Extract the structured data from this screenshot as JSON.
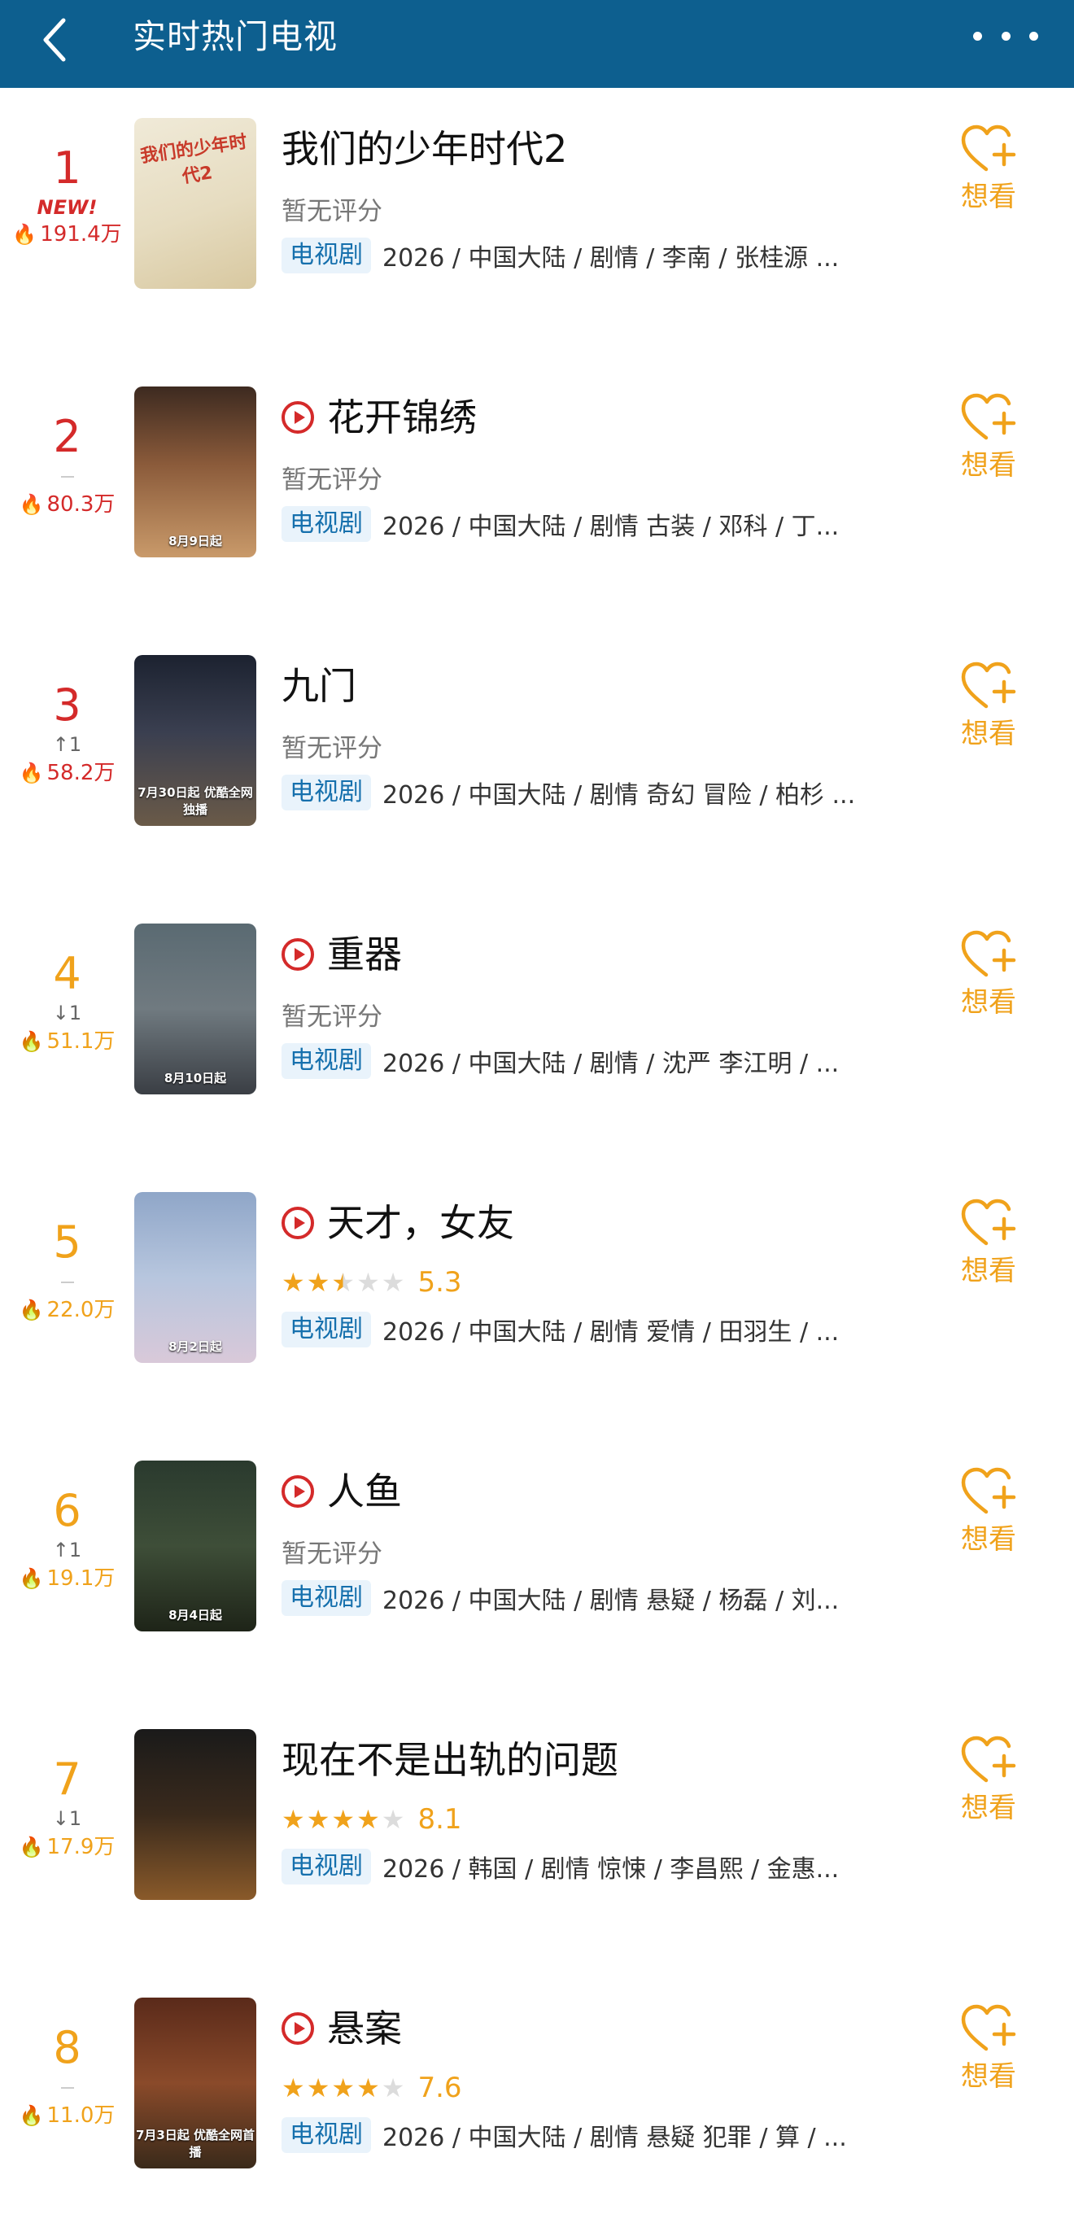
{
  "header": {
    "title": "实时热门电视",
    "back_icon": "back-arrow-icon",
    "more_icon": "more-dots-icon"
  },
  "no_rating_text": "暂无评分",
  "want_label": "想看",
  "colors": {
    "header_bg": "#0d5f8f",
    "hot": "#d42a2a",
    "warm": "#f0a21b",
    "tag_text": "#1670ad"
  },
  "items": [
    {
      "rank": "1",
      "is_new": true,
      "new_label": "NEW!",
      "change": "",
      "heat": "191.4万",
      "hot": true,
      "playable": false,
      "title": "我们的少年时代2",
      "rated": false,
      "stars": 0,
      "score": "",
      "tag": "电视剧",
      "meta": "2026 / 中国大陆 / 剧情 / 李南 / 张桂源 ...",
      "poster_text": "我们的少年时代2",
      "poster_caption": "",
      "poster_bg": "linear-gradient(160deg,#f0ead8 0%,#e6dcc0 55%,#d8c8a0 100%)"
    },
    {
      "rank": "2",
      "is_new": false,
      "new_label": "",
      "change": "",
      "heat": "80.3万",
      "hot": true,
      "playable": true,
      "title": "花开锦绣",
      "rated": false,
      "stars": 0,
      "score": "",
      "tag": "电视剧",
      "meta": "2026 / 中国大陆 / 剧情 古装 / 邓科 / 丁...",
      "poster_text": "",
      "poster_caption": "8月9日起",
      "poster_bg": "linear-gradient(180deg,#3d2a20 0%,#8a5a3a 45%,#c99a6a 100%)"
    },
    {
      "rank": "3",
      "is_new": false,
      "new_label": "",
      "change": "↑1",
      "heat": "58.2万",
      "hot": true,
      "playable": false,
      "title": "九门",
      "rated": false,
      "stars": 0,
      "score": "",
      "tag": "电视剧",
      "meta": "2026 / 中国大陆 / 剧情 奇幻 冒险 / 柏杉 ...",
      "poster_text": "",
      "poster_caption": "7月30日起 优酷全网独播",
      "poster_bg": "linear-gradient(180deg,#1c2230 0%,#3a3f50 45%,#6a5a48 100%)"
    },
    {
      "rank": "4",
      "is_new": false,
      "new_label": "",
      "change": "↓1",
      "heat": "51.1万",
      "hot": false,
      "playable": true,
      "title": "重器",
      "rated": false,
      "stars": 0,
      "score": "",
      "tag": "电视剧",
      "meta": "2026 / 中国大陆 / 剧情 / 沈严 李江明 / ...",
      "poster_text": "",
      "poster_caption": "8月10日起",
      "poster_bg": "linear-gradient(180deg,#5a6a72 0%,#707a80 50%,#3a3e44 100%)"
    },
    {
      "rank": "5",
      "is_new": false,
      "new_label": "",
      "change": "",
      "heat": "22.0万",
      "hot": false,
      "playable": true,
      "title": "天才，女友",
      "rated": true,
      "stars": 2.5,
      "score": "5.3",
      "tag": "电视剧",
      "meta": "2026 / 中国大陆 / 剧情 爱情 / 田羽生 / ...",
      "poster_text": "",
      "poster_caption": "8月2日起",
      "poster_bg": "linear-gradient(180deg,#8fa6c8 0%,#b7c6de 50%,#d9c9d9 100%)"
    },
    {
      "rank": "6",
      "is_new": false,
      "new_label": "",
      "change": "↑1",
      "heat": "19.1万",
      "hot": false,
      "playable": true,
      "title": "人鱼",
      "rated": false,
      "stars": 0,
      "score": "",
      "tag": "电视剧",
      "meta": "2026 / 中国大陆 / 剧情 悬疑 / 杨磊 / 刘...",
      "poster_text": "",
      "poster_caption": "8月4日起",
      "poster_bg": "linear-gradient(180deg,#2a3a2e 0%,#3e4e38 50%,#1e2418 100%)"
    },
    {
      "rank": "7",
      "is_new": false,
      "new_label": "",
      "change": "↓1",
      "heat": "17.9万",
      "hot": false,
      "playable": false,
      "title": "现在不是出轨的问题",
      "rated": true,
      "stars": 4,
      "score": "8.1",
      "tag": "电视剧",
      "meta": "2026 / 韩国 / 剧情 惊悚 / 李昌熙 / 金惠...",
      "poster_text": "",
      "poster_caption": "",
      "poster_bg": "linear-gradient(180deg,#1a1a1a 0%,#3a2a1c 50%,#8a5a2a 100%)"
    },
    {
      "rank": "8",
      "is_new": false,
      "new_label": "",
      "change": "",
      "heat": "11.0万",
      "hot": false,
      "playable": true,
      "title": "悬案",
      "rated": true,
      "stars": 4,
      "score": "7.6",
      "tag": "电视剧",
      "meta": "2026 / 中国大陆 / 剧情 悬疑 犯罪 / 算 / ...",
      "poster_text": "",
      "poster_caption": "7月3日起 优酷全网首播",
      "poster_bg": "linear-gradient(180deg,#5a2a1a 0%,#8a4a2a 50%,#3a2a1a 100%)"
    }
  ]
}
